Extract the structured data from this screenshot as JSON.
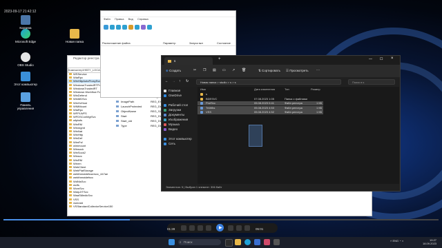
{
  "video": {
    "timestamp_overlay": "2023-09-17 21:42:12",
    "time_current": "01:28",
    "time_total": "05:01",
    "progress_fraction": 0.29
  },
  "desktop": {
    "icons": [
      {
        "label": "Корзина",
        "icon": "recycle-bin-icon"
      },
      {
        "label": "Microsoft Edge",
        "icon": "edge-icon"
      },
      {
        "label": "OBS Studio",
        "icon": "obs-icon"
      },
      {
        "label": "Этот компьютер",
        "icon": "computer-icon"
      },
      {
        "label": "Панель управления",
        "icon": "control-panel-icon"
      },
      {
        "label": "Новая папка",
        "icon": "folder-icon"
      }
    ]
  },
  "regedit": {
    "title": "Редактор реестра",
    "address": "Компьютер\\HKEY_LOCAL",
    "tree": [
      "WSService",
      "WiaRpc",
      "WinHttpAutoProxySvc",
      "WindowsTrustedRTProxy",
      "WindowsTrustedRT",
      "Windows Workflow Foundation 4",
      "WinDefend",
      "WinMDSvc",
      "WinHvHost",
      "WIMMount",
      "WiaRpc",
      "WFPLWFS",
      "WFDSConMgrSvc",
      "wfplwfs",
      "WinRM",
      "Winmgmt",
      "WinNat",
      "WinHttp",
      "WinDef",
      "WimFsf",
      "wimmount",
      "Winsock",
      "WinSock2",
      "Winsvc",
      "WinRM",
      "Winrm",
      "WebClient",
      "WebPlatStorage",
      "webthreatdefusersvc_447ae",
      "webthreatdefsvc",
      "WdNisSvc",
      "wcifs",
      "WcmSvc",
      "WarpJITSvc",
      "WaaSMedicSvc",
      "VSS",
      "vsmraid",
      "VSStandardCollectorService150"
    ],
    "values": [
      {
        "name": "FailureActions",
        "type": "REG_BINARY"
      },
      {
        "name": "ImagePath",
        "type": "REG_EXPAND_SZ"
      },
      {
        "name": "LaunchProtected",
        "type": "REG_DWORD"
      },
      {
        "name": "ObjectName",
        "type": "REG_SZ"
      },
      {
        "name": "Start",
        "type": "REG_DWORD"
      },
      {
        "name": "Start_old",
        "type": "REG_DWORD"
      },
      {
        "name": "Type",
        "type": "REG_DWORD"
      }
    ]
  },
  "autoruns": {
    "menu": [
      "Файл",
      "Правка",
      "Вид",
      "Справка"
    ],
    "columns": [
      "Расположение файла",
      "Параметр",
      "Запуск вкл",
      "Состояние"
    ]
  },
  "explorer": {
    "tab_title": "s",
    "toolbar": {
      "create": "Создать",
      "sort": "Сортировать",
      "view": "Просмотреть"
    },
    "address": "Новая папка > studio > s > s",
    "search_placeholder": "Поиск в s",
    "nav": [
      {
        "label": "Главная",
        "icon": "home-icon"
      },
      {
        "label": "OneDrive",
        "icon": "cloud-icon"
      },
      {
        "label": "Рабочий стол",
        "icon": "desktop-icon"
      },
      {
        "label": "Загрузки",
        "icon": "download-icon"
      },
      {
        "label": "Документы",
        "icon": "documents-icon"
      },
      {
        "label": "Изображения",
        "icon": "pictures-icon"
      },
      {
        "label": "Музыка",
        "icon": "music-icon"
      },
      {
        "label": "Видео",
        "icon": "video-icon"
      },
      {
        "label": "Этот компьютер",
        "icon": "computer-icon"
      },
      {
        "label": "Сеть",
        "icon": "network-icon"
      }
    ],
    "columns": [
      "Имя",
      "Дата изменения",
      "Тип",
      "Размер"
    ],
    "files": [
      {
        "name": "s",
        "date": "",
        "type": "",
        "size": ""
      },
      {
        "name": "BDESVC",
        "date": "07.08.2023 1:05",
        "type": "Папка с файлами",
        "size": ""
      },
      {
        "name": "ProfSvc",
        "date": "05.08.2023 0:41",
        "type": "Файл реестра",
        "size": "1 КБ"
      },
      {
        "name": "TrkWks",
        "date": "05.08.2023 4:53",
        "type": "Файл реестра",
        "size": "1 КБ"
      },
      {
        "name": "VSS",
        "date": "05.08.2023 4:52",
        "type": "Файл реестра",
        "size": "1 КБ"
      }
    ],
    "status": "Элементов: 5  |  Выбран 1 элемент: 306 байт"
  },
  "taskbar": {
    "search_label": "Поиск",
    "lang": "ENG",
    "time": "19:27",
    "date": "18.09.2023"
  }
}
